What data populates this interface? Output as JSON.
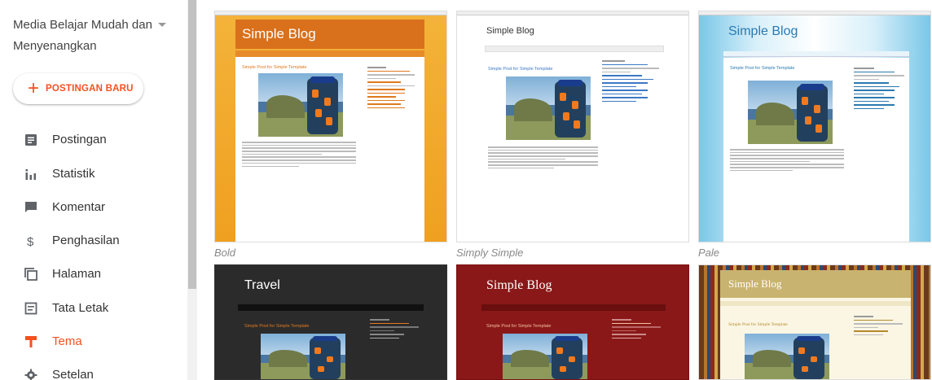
{
  "sidebar": {
    "blog_name": "Media Belajar Mudah dan Menyenangkan",
    "new_post_label": "POSTINGAN BARU",
    "items": [
      {
        "label": "Postingan",
        "icon": "posts-icon"
      },
      {
        "label": "Statistik",
        "icon": "stats-icon"
      },
      {
        "label": "Komentar",
        "icon": "comment-icon"
      },
      {
        "label": "Penghasilan",
        "icon": "dollar-icon"
      },
      {
        "label": "Halaman",
        "icon": "pages-icon"
      },
      {
        "label": "Tata Letak",
        "icon": "layout-icon"
      },
      {
        "label": "Tema",
        "icon": "theme-icon"
      },
      {
        "label": "Setelan",
        "icon": "gear-icon"
      }
    ],
    "active_item": "Tema"
  },
  "themes": [
    {
      "caption": "Bold",
      "blog_title": "Simple Blog",
      "post_title": "Simple Post for Simple Template"
    },
    {
      "caption": "Simply Simple",
      "blog_title": "Simple Blog",
      "post_title": "Simple Post for Simple Template"
    },
    {
      "caption": "Pale",
      "blog_title": "Simple Blog",
      "post_title": "Simple Post for Simple Template"
    },
    {
      "caption": "",
      "blog_title": "Travel",
      "post_title": "Simple Post for Simple Template"
    },
    {
      "caption": "",
      "blog_title": "Simple Blog",
      "post_title": "Simple Post for Simple Template"
    },
    {
      "caption": "",
      "blog_title": "Simple Blog",
      "post_title": "Simple Post for Simple Template"
    }
  ],
  "colors": {
    "accent": "#f4511e",
    "bold_bg": "#f0a020",
    "bold_header": "#e07a20",
    "pale_bg": "#8fd0ec",
    "travel_bg": "#2a2a2a",
    "red_bg": "#8c1a1a",
    "gold_header": "#c9b370"
  }
}
